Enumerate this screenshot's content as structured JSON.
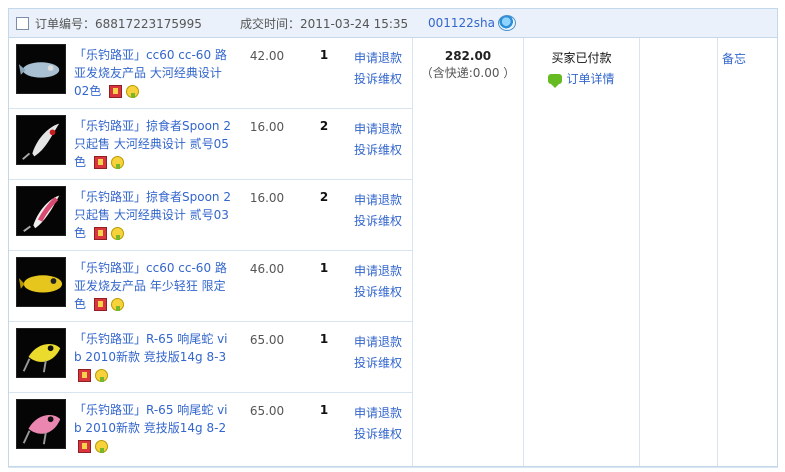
{
  "order": {
    "order_no_label": "订单编号：",
    "order_no": "68817223175995",
    "deal_time_label": "成交时间：",
    "deal_time": "2011-03-24 15:35",
    "seller": "001122sha",
    "total_amount": "282.00",
    "shipping_note": "（含快递:0.00 ）",
    "status": "买家已付款",
    "detail_link": "订单详情",
    "memo_link": "备忘"
  },
  "items": [
    {
      "title": "「乐钓路亚」cc60 cc-60 路亚发烧友产品 大河经典设计 02色",
      "price": "42.00",
      "qty": "1",
      "refund": "申请退款",
      "complain": "投诉维权",
      "thumb_color": "#9fb6c8"
    },
    {
      "title": "「乐钓路亚」掠食者Spoon 2只起售 大河经典设计 贰号05色",
      "price": "16.00",
      "qty": "2",
      "refund": "申请退款",
      "complain": "投诉维权",
      "thumb_color": "#d8d8d8"
    },
    {
      "title": "「乐钓路亚」掠食者Spoon 2只起售 大河经典设计 贰号03色",
      "price": "16.00",
      "qty": "2",
      "refund": "申请退款",
      "complain": "投诉维权",
      "thumb_color": "#d94a6a"
    },
    {
      "title": "「乐钓路亚」cc60 cc-60 路亚发烧友产品 年少轻狂 限定色",
      "price": "46.00",
      "qty": "1",
      "refund": "申请退款",
      "complain": "投诉维权",
      "thumb_color": "#e2c21a"
    },
    {
      "title": "「乐钓路亚」R-65 响尾蛇 vib 2010新款 竞技版14g 8-3",
      "price": "65.00",
      "qty": "1",
      "refund": "申请退款",
      "complain": "投诉维权",
      "thumb_color": "#e7d52c"
    },
    {
      "title": "「乐钓路亚」R-65 响尾蛇 vib 2010新款 竞技版14g 8-2",
      "price": "65.00",
      "qty": "1",
      "refund": "申请退款",
      "complain": "投诉维权",
      "thumb_color": "#e47ba5"
    }
  ]
}
